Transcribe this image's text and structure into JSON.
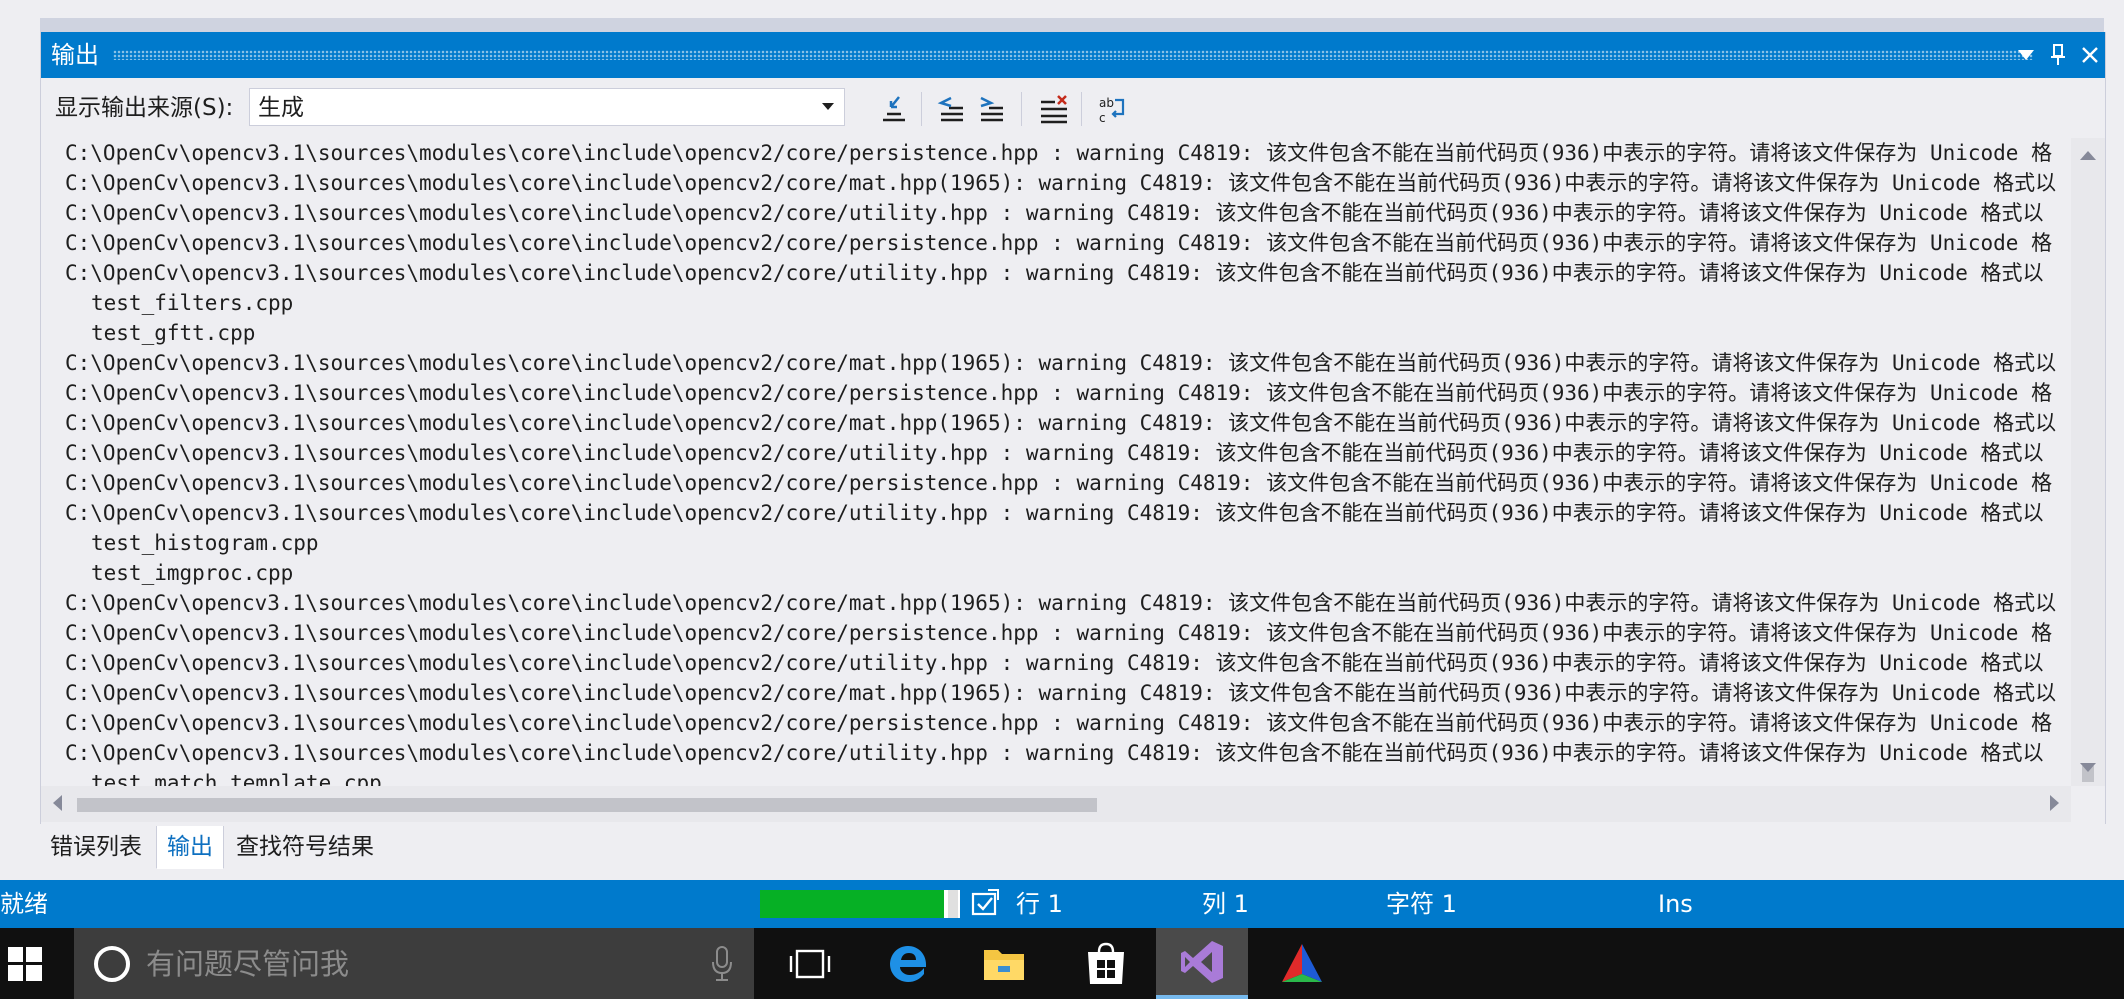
{
  "window": {
    "title": "输出"
  },
  "toolbar": {
    "source_label": "显示输出来源(S):",
    "source_value": "生成"
  },
  "output_lines": [
    "C:\\OpenCv\\opencv3.1\\sources\\modules\\core\\include\\opencv2/core/persistence.hpp : warning C4819: 该文件包含不能在当前代码页(936)中表示的字符。请将该文件保存为 Unicode 格",
    "C:\\OpenCv\\opencv3.1\\sources\\modules\\core\\include\\opencv2/core/mat.hpp(1965): warning C4819: 该文件包含不能在当前代码页(936)中表示的字符。请将该文件保存为 Unicode 格式以",
    "C:\\OpenCv\\opencv3.1\\sources\\modules\\core\\include\\opencv2/core/utility.hpp : warning C4819: 该文件包含不能在当前代码页(936)中表示的字符。请将该文件保存为 Unicode 格式以",
    "C:\\OpenCv\\opencv3.1\\sources\\modules\\core\\include\\opencv2/core/persistence.hpp : warning C4819: 该文件包含不能在当前代码页(936)中表示的字符。请将该文件保存为 Unicode 格",
    "C:\\OpenCv\\opencv3.1\\sources\\modules\\core\\include\\opencv2/core/utility.hpp : warning C4819: 该文件包含不能在当前代码页(936)中表示的字符。请将该文件保存为 Unicode 格式以",
    "test_filters.cpp",
    "test_gftt.cpp",
    "C:\\OpenCv\\opencv3.1\\sources\\modules\\core\\include\\opencv2/core/mat.hpp(1965): warning C4819: 该文件包含不能在当前代码页(936)中表示的字符。请将该文件保存为 Unicode 格式以",
    "C:\\OpenCv\\opencv3.1\\sources\\modules\\core\\include\\opencv2/core/persistence.hpp : warning C4819: 该文件包含不能在当前代码页(936)中表示的字符。请将该文件保存为 Unicode 格",
    "C:\\OpenCv\\opencv3.1\\sources\\modules\\core\\include\\opencv2/core/mat.hpp(1965): warning C4819: 该文件包含不能在当前代码页(936)中表示的字符。请将该文件保存为 Unicode 格式以",
    "C:\\OpenCv\\opencv3.1\\sources\\modules\\core\\include\\opencv2/core/utility.hpp : warning C4819: 该文件包含不能在当前代码页(936)中表示的字符。请将该文件保存为 Unicode 格式以",
    "C:\\OpenCv\\opencv3.1\\sources\\modules\\core\\include\\opencv2/core/persistence.hpp : warning C4819: 该文件包含不能在当前代码页(936)中表示的字符。请将该文件保存为 Unicode 格",
    "C:\\OpenCv\\opencv3.1\\sources\\modules\\core\\include\\opencv2/core/utility.hpp : warning C4819: 该文件包含不能在当前代码页(936)中表示的字符。请将该文件保存为 Unicode 格式以",
    "test_histogram.cpp",
    "test_imgproc.cpp",
    "C:\\OpenCv\\opencv3.1\\sources\\modules\\core\\include\\opencv2/core/mat.hpp(1965): warning C4819: 该文件包含不能在当前代码页(936)中表示的字符。请将该文件保存为 Unicode 格式以",
    "C:\\OpenCv\\opencv3.1\\sources\\modules\\core\\include\\opencv2/core/persistence.hpp : warning C4819: 该文件包含不能在当前代码页(936)中表示的字符。请将该文件保存为 Unicode 格",
    "C:\\OpenCv\\opencv3.1\\sources\\modules\\core\\include\\opencv2/core/utility.hpp : warning C4819: 该文件包含不能在当前代码页(936)中表示的字符。请将该文件保存为 Unicode 格式以",
    "C:\\OpenCv\\opencv3.1\\sources\\modules\\core\\include\\opencv2/core/mat.hpp(1965): warning C4819: 该文件包含不能在当前代码页(936)中表示的字符。请将该文件保存为 Unicode 格式以",
    "C:\\OpenCv\\opencv3.1\\sources\\modules\\core\\include\\opencv2/core/persistence.hpp : warning C4819: 该文件包含不能在当前代码页(936)中表示的字符。请将该文件保存为 Unicode 格",
    "C:\\OpenCv\\opencv3.1\\sources\\modules\\core\\include\\opencv2/core/utility.hpp : warning C4819: 该文件包含不能在当前代码页(936)中表示的字符。请将该文件保存为 Unicode 格式以",
    "test_match_template.cpp"
  ],
  "tabs": [
    "错误列表",
    "输出",
    "查找符号结果"
  ],
  "status": {
    "ready": "就绪",
    "row": "行 1",
    "col": "列 1",
    "char": "字符 1",
    "ins": "Ins",
    "progress": 0.92
  },
  "taskbar": {
    "search_placeholder": "有问题尽管问我"
  },
  "colors": {
    "accent": "#007acc",
    "progress": "#06b025",
    "taskbar": "#101010"
  },
  "icons": {
    "pane": [
      "dropdown-icon",
      "pin-icon",
      "close-icon"
    ],
    "toolbar": [
      "find-message-icon",
      "prev-message-icon",
      "next-message-icon",
      "clear-all-icon",
      "toggle-word-wrap-icon"
    ],
    "taskbar": [
      "windows-start-icon",
      "cortana-icon",
      "microphone-icon",
      "task-view-icon",
      "edge-icon",
      "file-explorer-icon",
      "store-icon",
      "visual-studio-icon",
      "app-icon"
    ]
  }
}
